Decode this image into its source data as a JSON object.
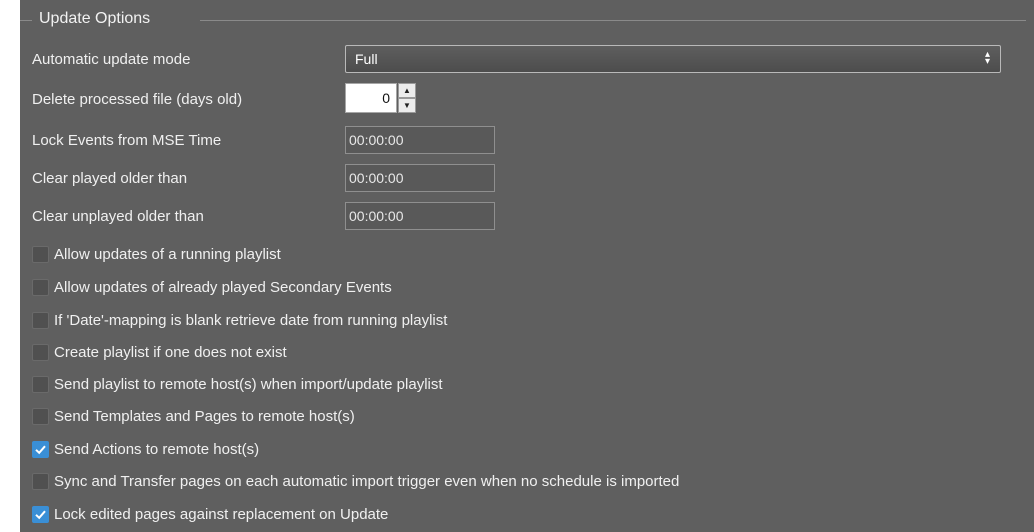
{
  "group": {
    "title": "Update Options"
  },
  "fields": {
    "automatic_update_mode": {
      "label": "Automatic update mode",
      "value": "Full"
    },
    "delete_processed_file": {
      "label": "Delete processed file (days old)",
      "value": "0"
    },
    "lock_events": {
      "label": "Lock Events from MSE Time",
      "value": "00:00:00"
    },
    "clear_played": {
      "label": "Clear played older than",
      "value": "00:00:00"
    },
    "clear_unplayed": {
      "label": "Clear unplayed older than",
      "value": "00:00:00"
    }
  },
  "checkboxes": [
    {
      "label": "Allow updates of a running playlist",
      "checked": false
    },
    {
      "label": "Allow updates of already played Secondary Events",
      "checked": false
    },
    {
      "label": "If 'Date'-mapping is blank retrieve date from running playlist",
      "checked": false
    },
    {
      "label": "Create playlist if one does not exist",
      "checked": false
    },
    {
      "label": "Send playlist to remote host(s) when import/update playlist",
      "checked": false
    },
    {
      "label": "Send Templates and Pages to remote host(s)",
      "checked": false
    },
    {
      "label": "Send Actions to remote host(s)",
      "checked": true
    },
    {
      "label": "Sync and Transfer pages on each automatic import trigger even when no schedule is imported",
      "checked": false
    },
    {
      "label": "Lock edited pages against replacement on Update",
      "checked": true
    }
  ],
  "icons": {
    "select_arrow": "chevron-up-down-icon",
    "spin_up": "arrow-up-icon",
    "spin_down": "arrow-down-icon",
    "check": "checkmark-icon"
  },
  "colors": {
    "panel_bg": "#5f5f5f",
    "check_accent": "#3a8fd6"
  }
}
